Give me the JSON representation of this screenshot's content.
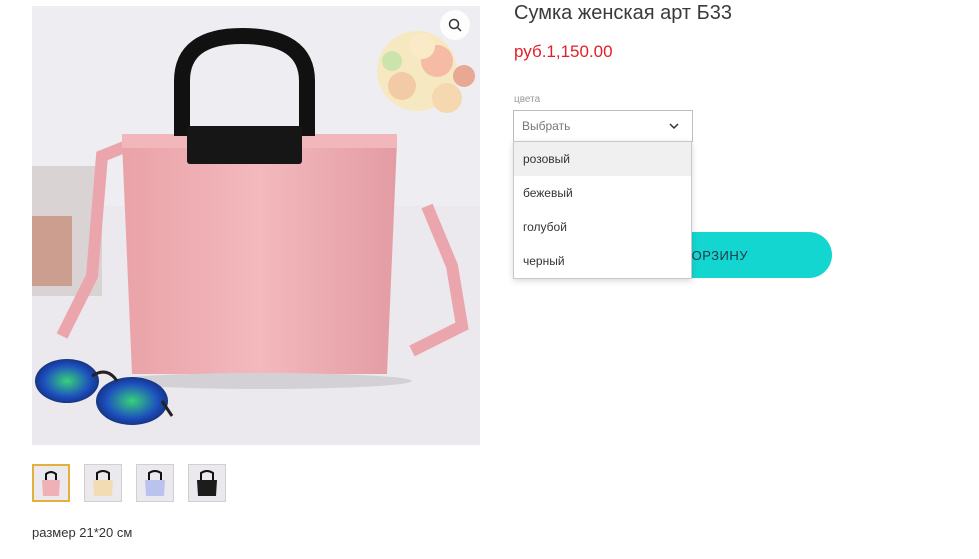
{
  "product": {
    "title": "Сумка женская арт Б33",
    "price": "руб.1,150.00",
    "size_note": "размер 21*20 см"
  },
  "variant": {
    "label": "цвета",
    "placeholder": "Выбрать",
    "options": [
      "розовый",
      "бежевый",
      "голубой",
      "черный"
    ],
    "highlighted_option": "розовый"
  },
  "cart_button": {
    "label": "ДОБАВИТЬ В КОРЗИНУ",
    "visible_label": "ОРЗИНУ"
  },
  "thumbnails": [
    {
      "name": "pink",
      "color": "#f0b1b6"
    },
    {
      "name": "beige",
      "color": "#f1dcb4"
    },
    {
      "name": "blue",
      "color": "#b9c3ee"
    },
    {
      "name": "black",
      "color": "#1c1c1c"
    }
  ],
  "colors": {
    "accent": "#14d6d0",
    "price": "#e0202a",
    "thumb_active_border": "#e2b13c"
  },
  "icons": {
    "zoom": "zoom-icon",
    "dropdown": "chevron-down-icon"
  }
}
